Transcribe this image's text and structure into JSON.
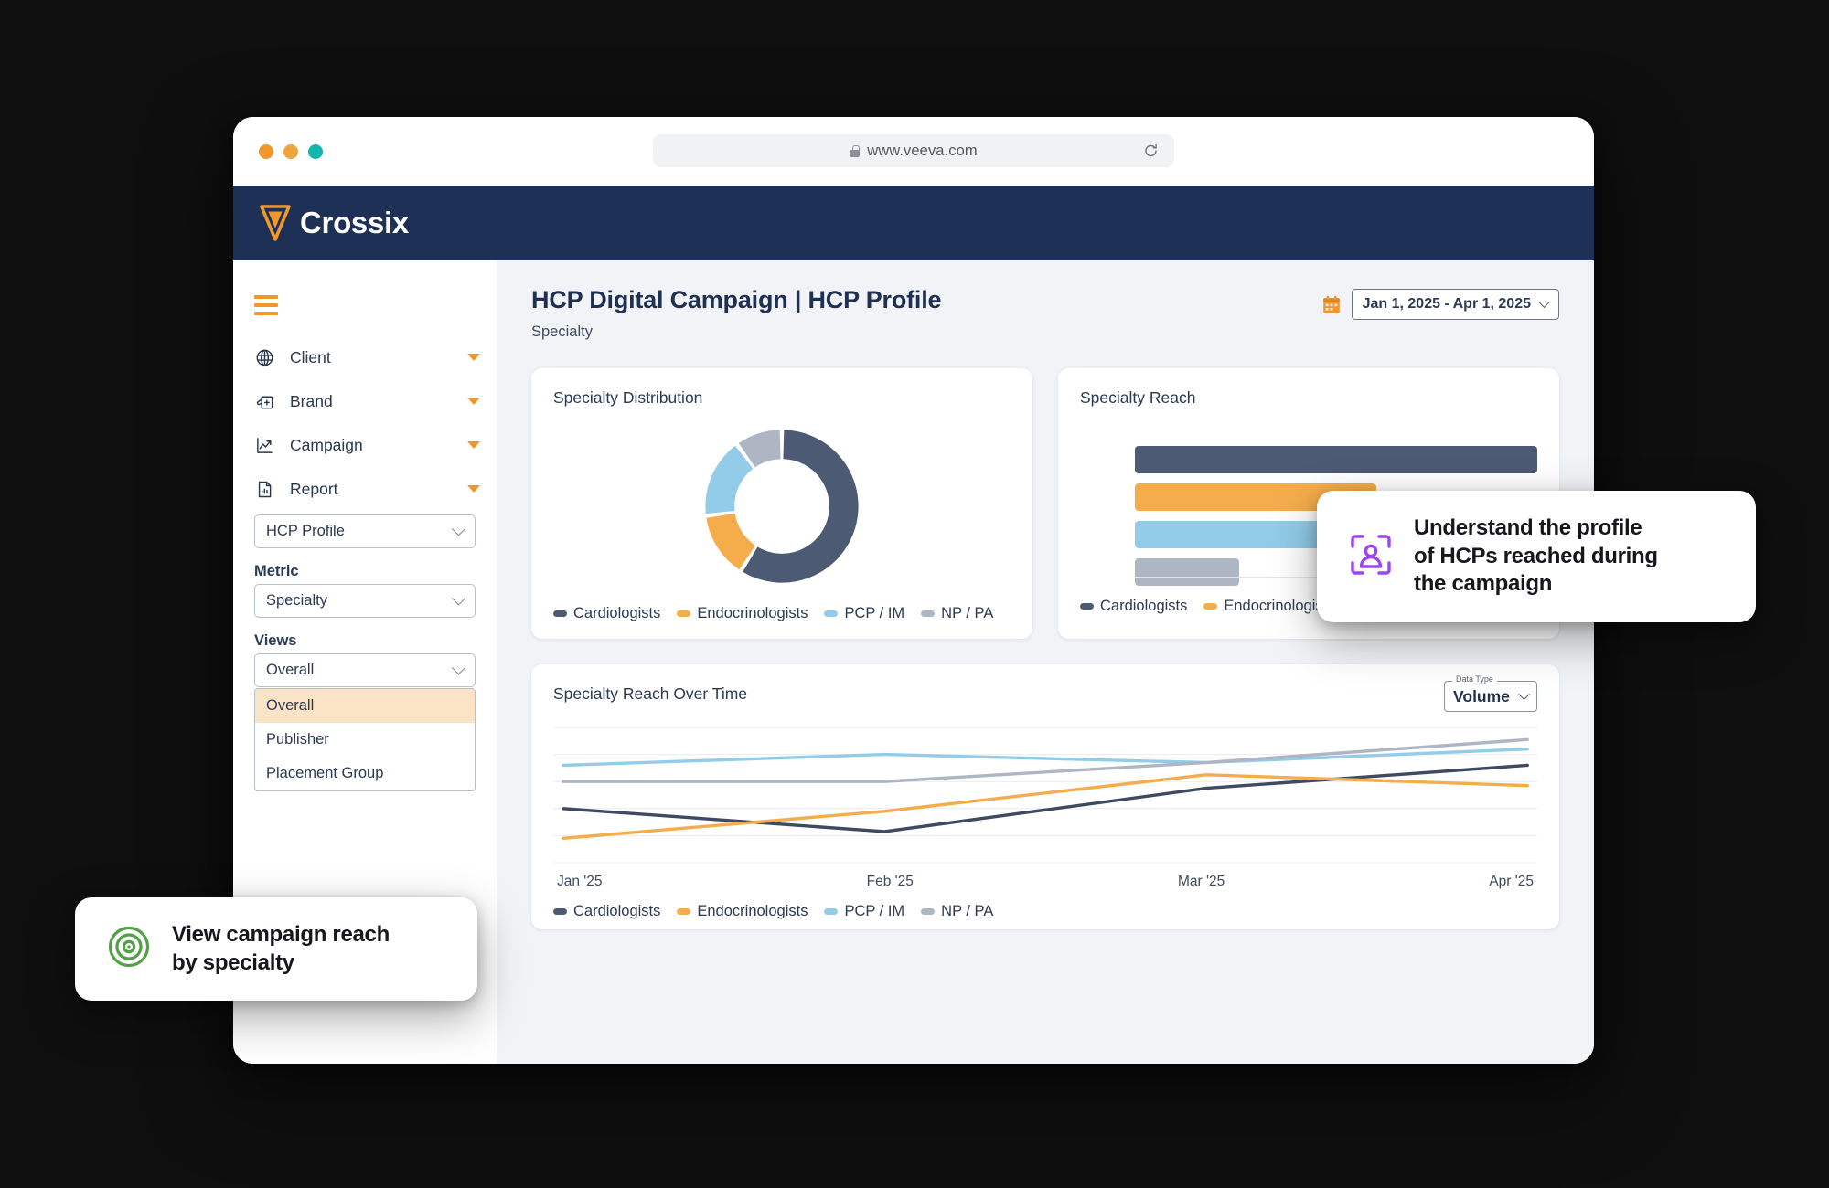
{
  "browser": {
    "url": "www.veeva.com",
    "lock_icon": "lock-icon",
    "reload_icon": "reload-icon"
  },
  "brand": {
    "name": "Crossix",
    "logo_icon": "crossix-logo-icon"
  },
  "sidebar": {
    "menu_icon": "hamburger-menu-icon",
    "items": [
      {
        "label": "Client",
        "icon": "globe-icon"
      },
      {
        "label": "Brand",
        "icon": "pill-bottle-icon"
      },
      {
        "label": "Campaign",
        "icon": "trending-chart-icon"
      },
      {
        "label": "Report",
        "icon": "report-document-icon"
      }
    ],
    "report_select": {
      "value": "HCP Profile"
    },
    "metric": {
      "label": "Metric",
      "value": "Specialty"
    },
    "views": {
      "label": "Views",
      "value": "Overall",
      "options": [
        "Overall",
        "Publisher",
        "Placement Group"
      ],
      "selected_index": 0
    }
  },
  "header": {
    "title": "HCP Digital Campaign | HCP Profile",
    "subtitle": "Specialty",
    "calendar_icon": "calendar-icon",
    "date_range": "Jan 1, 2025 - Apr 1, 2025"
  },
  "colors": {
    "cardiologists": "#4d5a74",
    "endocrinologists": "#f5ad4c",
    "pcp_im": "#92cce9",
    "np_pa": "#aeb6c4",
    "brand_navy": "#1e3055",
    "brand_orange": "#f2962e",
    "highlight": "#fbe3c6",
    "callout_purple": "#9b46f0",
    "callout_green": "#52a046"
  },
  "legend": [
    {
      "label": "Cardiologists",
      "color": "#4d5a74"
    },
    {
      "label": "Endocrinologists",
      "color": "#f5ad4c"
    },
    {
      "label": "PCP / IM",
      "color": "#92cce9"
    },
    {
      "label": "NP / PA",
      "color": "#aeb6c4"
    }
  ],
  "cards": {
    "distribution_title": "Specialty Distribution",
    "reach_title": "Specialty Reach",
    "overtime_title": "Specialty Reach Over Time",
    "datatype": {
      "label": "Data Type",
      "value": "Volume"
    }
  },
  "callouts": [
    {
      "id": "callout-right",
      "icon": "hcp-profile-scan-icon",
      "text": "Understand the profile\nof HCPs reached during\nthe campaign"
    },
    {
      "id": "callout-left",
      "icon": "target-icon",
      "text": "View campaign reach\nby specialty"
    }
  ],
  "chart_data": [
    {
      "type": "pie",
      "title": "Specialty Distribution",
      "labels": [
        "Cardiologists",
        "Endocrinologists",
        "PCP / IM",
        "NP / PA"
      ],
      "values": [
        59,
        14,
        17,
        10
      ],
      "colors": [
        "#4d5a74",
        "#f5ad4c",
        "#92cce9",
        "#aeb6c4"
      ],
      "donut": true,
      "inner_radius_ratio": 0.62,
      "legend": "bottom"
    },
    {
      "type": "bar",
      "orientation": "horizontal",
      "title": "Specialty Reach",
      "categories": [
        "Cardiologists",
        "Endocrinologists",
        "PCP / IM",
        "NP / PA"
      ],
      "values": [
        100,
        60,
        72,
        26
      ],
      "colors": [
        "#4d5a74",
        "#f5ad4c",
        "#92cce9",
        "#aeb6c4"
      ],
      "xlim": [
        0,
        100
      ],
      "grid": false,
      "legend": "bottom"
    },
    {
      "type": "line",
      "title": "Specialty Reach Over Time",
      "x": [
        "Jan '25",
        "Feb '25",
        "Mar '25",
        "Apr '25"
      ],
      "xlabel": "",
      "ylabel": "",
      "ylim": [
        0,
        100
      ],
      "grid": true,
      "legend": "bottom",
      "series": [
        {
          "name": "Cardiologists",
          "color": "#3e4a60",
          "values": [
            40,
            23,
            55,
            72
          ]
        },
        {
          "name": "Endocrinologists",
          "color": "#f5ad4c",
          "values": [
            18,
            38,
            65,
            57
          ]
        },
        {
          "name": "PCP / IM",
          "color": "#92cce9",
          "values": [
            72,
            80,
            74,
            84
          ]
        },
        {
          "name": "NP / PA",
          "color": "#aeb6c4",
          "values": [
            60,
            60,
            74,
            91
          ]
        }
      ]
    }
  ]
}
